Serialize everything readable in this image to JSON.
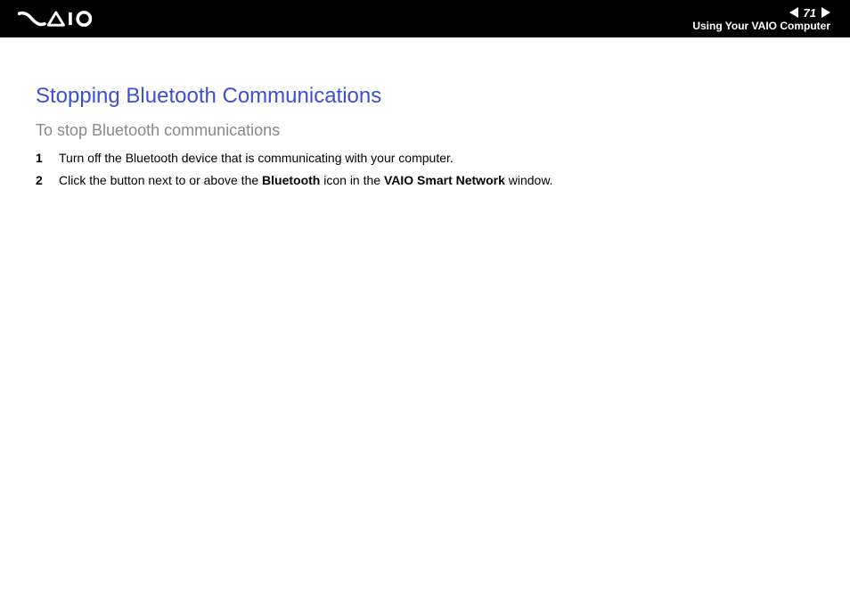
{
  "header": {
    "page_number": "71",
    "section": "Using Your VAIO Computer"
  },
  "content": {
    "title": "Stopping Bluetooth Communications",
    "subtitle": "To stop Bluetooth communications",
    "steps": [
      {
        "text": "Turn off the Bluetooth device that is communicating with your computer."
      },
      {
        "prefix": "Click the button next to or above the ",
        "bold1": "Bluetooth",
        "mid": " icon in the ",
        "bold2": "VAIO Smart Network",
        "suffix": " window."
      }
    ]
  }
}
